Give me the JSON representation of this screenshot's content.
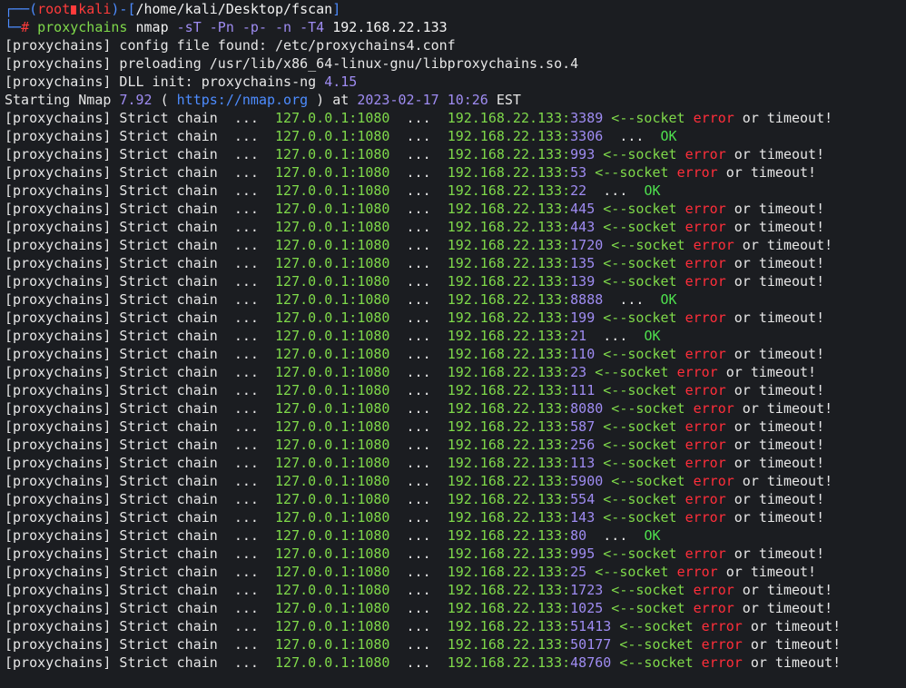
{
  "prompt": {
    "corner_top": "┌──",
    "user": "root",
    "host": "kali",
    "dash": "-",
    "path": "/home/kali/Desktop/fscan",
    "corner_bottom": "└─",
    "symbol": "#",
    "cmd": "proxychains",
    "cmd2": "nmap",
    "args": "-sT -Pn -p- -n -T4",
    "target": "192.168.22.133"
  },
  "info": [
    {
      "tag": "[proxychains]",
      "text": " config file found: /etc/proxychains4.conf"
    },
    {
      "tag": "[proxychains]",
      "text": " preloading /usr/lib/x86_64-linux-gnu/libproxychains.so.4"
    },
    {
      "tag": "[proxychains]",
      "text": " DLL init: proxychains-ng ",
      "version": "4.15"
    }
  ],
  "nmap_start": {
    "prefix": "Starting Nmap ",
    "version": "7.92",
    "open": " ( ",
    "url": "https://nmap.org",
    "close": " )",
    "at": " at ",
    "date": "2023-02-17",
    "time": "10:26",
    "tz": " EST"
  },
  "chain": {
    "tag": "[proxychains]",
    "label": " Strict chain",
    "dots": "  ...  ",
    "proxy": "127.0.0.1:1080",
    "host": "192.168.22.133",
    "arrow": " <--socket ",
    "error": "error",
    "timeout": " or timeout!",
    "ok_dots": "  ...  ",
    "ok": "OK"
  },
  "ports": [
    {
      "port": "3389",
      "status": "fail"
    },
    {
      "port": "3306",
      "status": "ok"
    },
    {
      "port": "993",
      "status": "fail"
    },
    {
      "port": "53",
      "status": "fail"
    },
    {
      "port": "22",
      "status": "ok"
    },
    {
      "port": "445",
      "status": "fail"
    },
    {
      "port": "443",
      "status": "fail"
    },
    {
      "port": "1720",
      "status": "fail"
    },
    {
      "port": "135",
      "status": "fail"
    },
    {
      "port": "139",
      "status": "fail"
    },
    {
      "port": "8888",
      "status": "ok"
    },
    {
      "port": "199",
      "status": "fail"
    },
    {
      "port": "21",
      "status": "ok"
    },
    {
      "port": "110",
      "status": "fail"
    },
    {
      "port": "23",
      "status": "fail"
    },
    {
      "port": "111",
      "status": "fail"
    },
    {
      "port": "8080",
      "status": "fail"
    },
    {
      "port": "587",
      "status": "fail"
    },
    {
      "port": "256",
      "status": "fail"
    },
    {
      "port": "113",
      "status": "fail"
    },
    {
      "port": "5900",
      "status": "fail"
    },
    {
      "port": "554",
      "status": "fail"
    },
    {
      "port": "143",
      "status": "fail"
    },
    {
      "port": "80",
      "status": "ok"
    },
    {
      "port": "995",
      "status": "fail"
    },
    {
      "port": "25",
      "status": "fail"
    },
    {
      "port": "1723",
      "status": "fail"
    },
    {
      "port": "1025",
      "status": "fail"
    },
    {
      "port": "51413",
      "status": "fail"
    },
    {
      "port": "50177",
      "status": "fail"
    },
    {
      "port": "48760",
      "status": "fail"
    }
  ],
  "colors": {
    "background": "#1b1d21",
    "prompt_blue": "#4d8cff",
    "prompt_red": "#ff3b3b",
    "command_green": "#7fd94a",
    "number_purple": "#9f8cf2",
    "ok_green": "#4ee04e",
    "error_red": "#ff2e3a"
  }
}
